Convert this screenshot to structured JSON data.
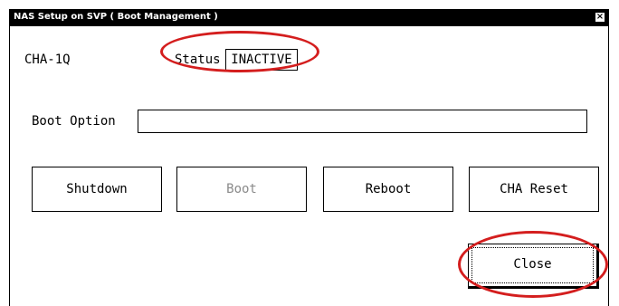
{
  "window": {
    "title": "NAS Setup on SVP ( Boot Management )",
    "close_glyph": "×"
  },
  "device": {
    "name": "CHA-1Q",
    "status_label": "Status",
    "status_value": "INACTIVE"
  },
  "boot_option": {
    "label": "Boot Option",
    "value": ""
  },
  "actions": {
    "shutdown": "Shutdown",
    "boot": "Boot",
    "reboot": "Reboot",
    "cha_reset": "CHA Reset"
  },
  "close_button": "Close",
  "colors": {
    "annotation": "#d41e1e",
    "titlebar": "#000000",
    "disabled_text": "#8a8a8a"
  }
}
